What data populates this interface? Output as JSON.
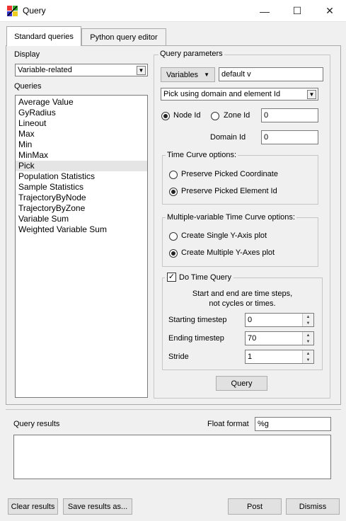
{
  "window": {
    "title": "Query",
    "controls": {
      "minimize": "—",
      "maximize": "☐",
      "close": "✕"
    }
  },
  "tabs": [
    {
      "label": "Standard queries",
      "active": true
    },
    {
      "label": "Python query editor",
      "active": false
    }
  ],
  "display": {
    "label": "Display",
    "selected": "Variable-related"
  },
  "queries": {
    "label": "Queries",
    "items": [
      "Average Value",
      "GyRadius",
      "Lineout",
      "Max",
      "Min",
      "MinMax",
      "Pick",
      "Population Statistics",
      "Sample Statistics",
      "TrajectoryByNode",
      "TrajectoryByZone",
      "Variable Sum",
      "Weighted Variable Sum"
    ],
    "selected_index": 6
  },
  "params": {
    "title": "Query parameters",
    "variables_button": "Variables",
    "variables_value": "default v",
    "pick_mode": "Pick using domain and element Id",
    "node_id_label": "Node Id",
    "zone_id_label": "Zone Id",
    "element_id_value": "0",
    "domain_id_label": "Domain Id",
    "domain_id_value": "0",
    "time_curve": {
      "title": "Time Curve options:",
      "opt1": "Preserve Picked Coordinate",
      "opt2": "Preserve Picked Element Id"
    },
    "multi_var": {
      "title": "Multiple-variable Time Curve options:",
      "opt1": "Create Single Y-Axis plot",
      "opt2": "Create Multiple Y-Axes plot"
    },
    "time_query": {
      "checkbox_label": "Do Time Query",
      "checked": true,
      "note_line1": "Start and end are time steps,",
      "note_line2": "not cycles or times.",
      "start_label": "Starting timestep",
      "start_value": "0",
      "end_label": "Ending timestep",
      "end_value": "70",
      "stride_label": "Stride",
      "stride_value": "1"
    },
    "query_button": "Query"
  },
  "results": {
    "label": "Query results",
    "float_format_label": "Float format",
    "float_format_value": "%g"
  },
  "bottom": {
    "clear": "Clear results",
    "save": "Save results as...",
    "post": "Post",
    "dismiss": "Dismiss"
  }
}
